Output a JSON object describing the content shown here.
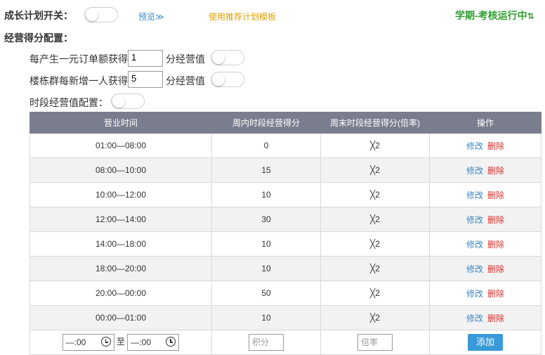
{
  "header": {
    "growth_switch_label": "成长计划开关：",
    "preview_link": "预览≫",
    "template_link": "使用推荐计划模板",
    "semester_title": "学期-考核运行中"
  },
  "config": {
    "section_title": "经营得分配置：",
    "order_prefix": "每产生一元订单额获得",
    "order_value": "1",
    "order_suffix": "分经营值",
    "member_prefix": "楼栋群每新增一人获得",
    "member_value": "5",
    "member_suffix": "分经营值",
    "period_label": "时段经营值配置："
  },
  "table": {
    "columns": [
      "营业时间",
      "周内时段经营得分",
      "周末时段经营得分(倍率)",
      "操作"
    ],
    "rows": [
      {
        "time": "01:00—08:00",
        "weekday": "0",
        "weekend": "╳2"
      },
      {
        "time": "08:00—10:00",
        "weekday": "15",
        "weekend": "╳2"
      },
      {
        "time": "10:00—12:00",
        "weekday": "10",
        "weekend": "╳2"
      },
      {
        "time": "12:00—14:00",
        "weekday": "30",
        "weekend": "╳2"
      },
      {
        "time": "14:00—18:00",
        "weekday": "10",
        "weekend": "╳2"
      },
      {
        "time": "18:00—20:00",
        "weekday": "10",
        "weekend": "╳2"
      },
      {
        "time": "20:00—00:00",
        "weekday": "50",
        "weekend": "╳2"
      },
      {
        "time": "00:00—01:00",
        "weekday": "10",
        "weekend": "╳2"
      }
    ],
    "edit_label": "修改",
    "delete_label": "删除"
  },
  "add_row": {
    "start_time": "—:00",
    "to_label": "至",
    "end_time": "—:00",
    "score_placeholder": "积分",
    "rate_placeholder": "倍率",
    "add_button": "添加"
  }
}
